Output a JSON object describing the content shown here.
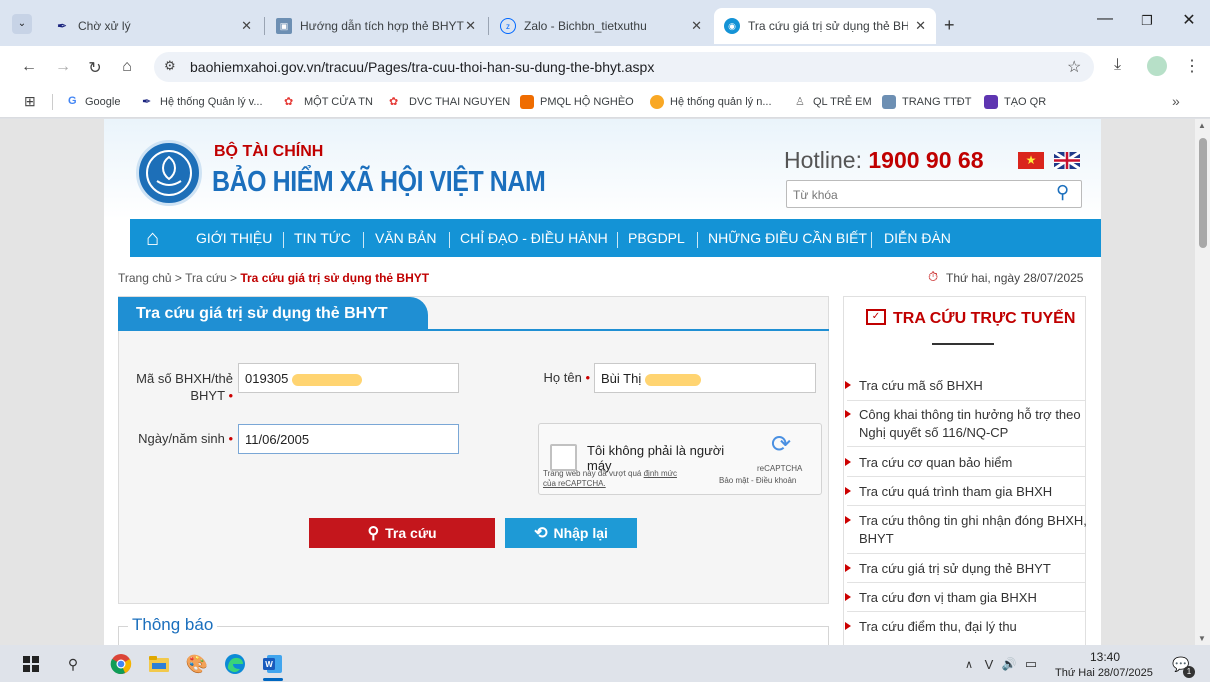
{
  "browser": {
    "tabs": [
      {
        "title": "Chờ xử lý",
        "active": false
      },
      {
        "title": "Hướng dẫn tích hợp thẻ BHYT",
        "active": false
      },
      {
        "title": "Zalo - Bichbn_tietxuthu",
        "active": false
      },
      {
        "title": "Tra cứu giá trị sử dụng thẻ BHY",
        "active": true
      }
    ],
    "new_tab": "+",
    "url": "baohiemxahoi.gov.vn/tracuu/Pages/tra-cuu-thoi-han-su-dung-the-bhyt.aspx",
    "bookmarks": [
      "Google",
      "Hệ thống Quản lý v...",
      "MỘT CỬA TN",
      "DVC THAI NGUYEN",
      "PMQL HỘ NGHÈO",
      "Hệ thống quản lý n...",
      "QL TRẺ EM",
      "TRANG TTĐT",
      "TẠO QR"
    ],
    "bookmarks_more": "»"
  },
  "site": {
    "org_top": "BỘ TÀI CHÍNH",
    "org_name": "BẢO HIỂM XÃ HỘI VIỆT NAM",
    "hotline_label": "Hotline:",
    "hotline_number": "1900 90 68",
    "search_placeholder": "Từ khóa",
    "nav": [
      "GIỚI THIỆU",
      "TIN TỨC",
      "VĂN BẢN",
      "CHỈ ĐẠO - ĐIỀU HÀNH",
      "PBGDPL",
      "NHỮNG ĐIỀU CẦN BIẾT",
      "DIỄN ĐÀN"
    ],
    "breadcrumb": {
      "home": "Trang chủ >",
      "section": "Tra cứu >",
      "current": "Tra cứu giá trị sử dụng thẻ BHYT"
    },
    "date": "Thứ hai, ngày 28/07/2025"
  },
  "form": {
    "title": "Tra cứu giá trị sử dụng thẻ BHYT",
    "id_label_1": "Mã số BHXH/thẻ",
    "id_label_2": "BHYT",
    "id_value": "019305",
    "name_label": "Họ tên",
    "name_value": "Bùi Thị",
    "dob_label": "Ngày/năm sinh",
    "dob_value": "11/06/2005",
    "req_mark": "•",
    "captcha": {
      "text": "Tôi không phải là người máy",
      "brand": "reCAPTCHA",
      "links": "Bảo mật - Điều khoản",
      "note_1": "Trang web này đã vượt quá",
      "note_link": "định mức",
      "note_2": "của reCAPTCHA."
    },
    "search_button": "Tra cứu",
    "reset_button": "Nhập lại"
  },
  "notice": {
    "title": "Thông báo"
  },
  "sidebar": {
    "title": "TRA CỨU TRỰC TUYẾN",
    "links": [
      "Tra cứu mã số BHXH",
      "Công khai thông tin hưởng hỗ trợ theo Nghị quyết số 116/NQ-CP",
      "Tra cứu cơ quan bảo hiểm",
      "Tra cứu quá trình tham gia BHXH",
      "Tra cứu thông tin ghi nhận đóng BHXH, BHYT",
      "Tra cứu giá trị sử dụng thẻ BHYT",
      "Tra cứu đơn vị tham gia BHXH",
      "Tra cứu điểm thu, đại lý thu"
    ]
  },
  "taskbar": {
    "time": "13:40",
    "date": "Thứ Hai 28/07/2025",
    "notif_count": "1"
  },
  "colors": {
    "nav_blue": "#1493d6",
    "red": "#c00000",
    "button_red": "#c4161c",
    "button_blue": "#1e9ad6",
    "form_title_blue": "#1f8fd3"
  }
}
